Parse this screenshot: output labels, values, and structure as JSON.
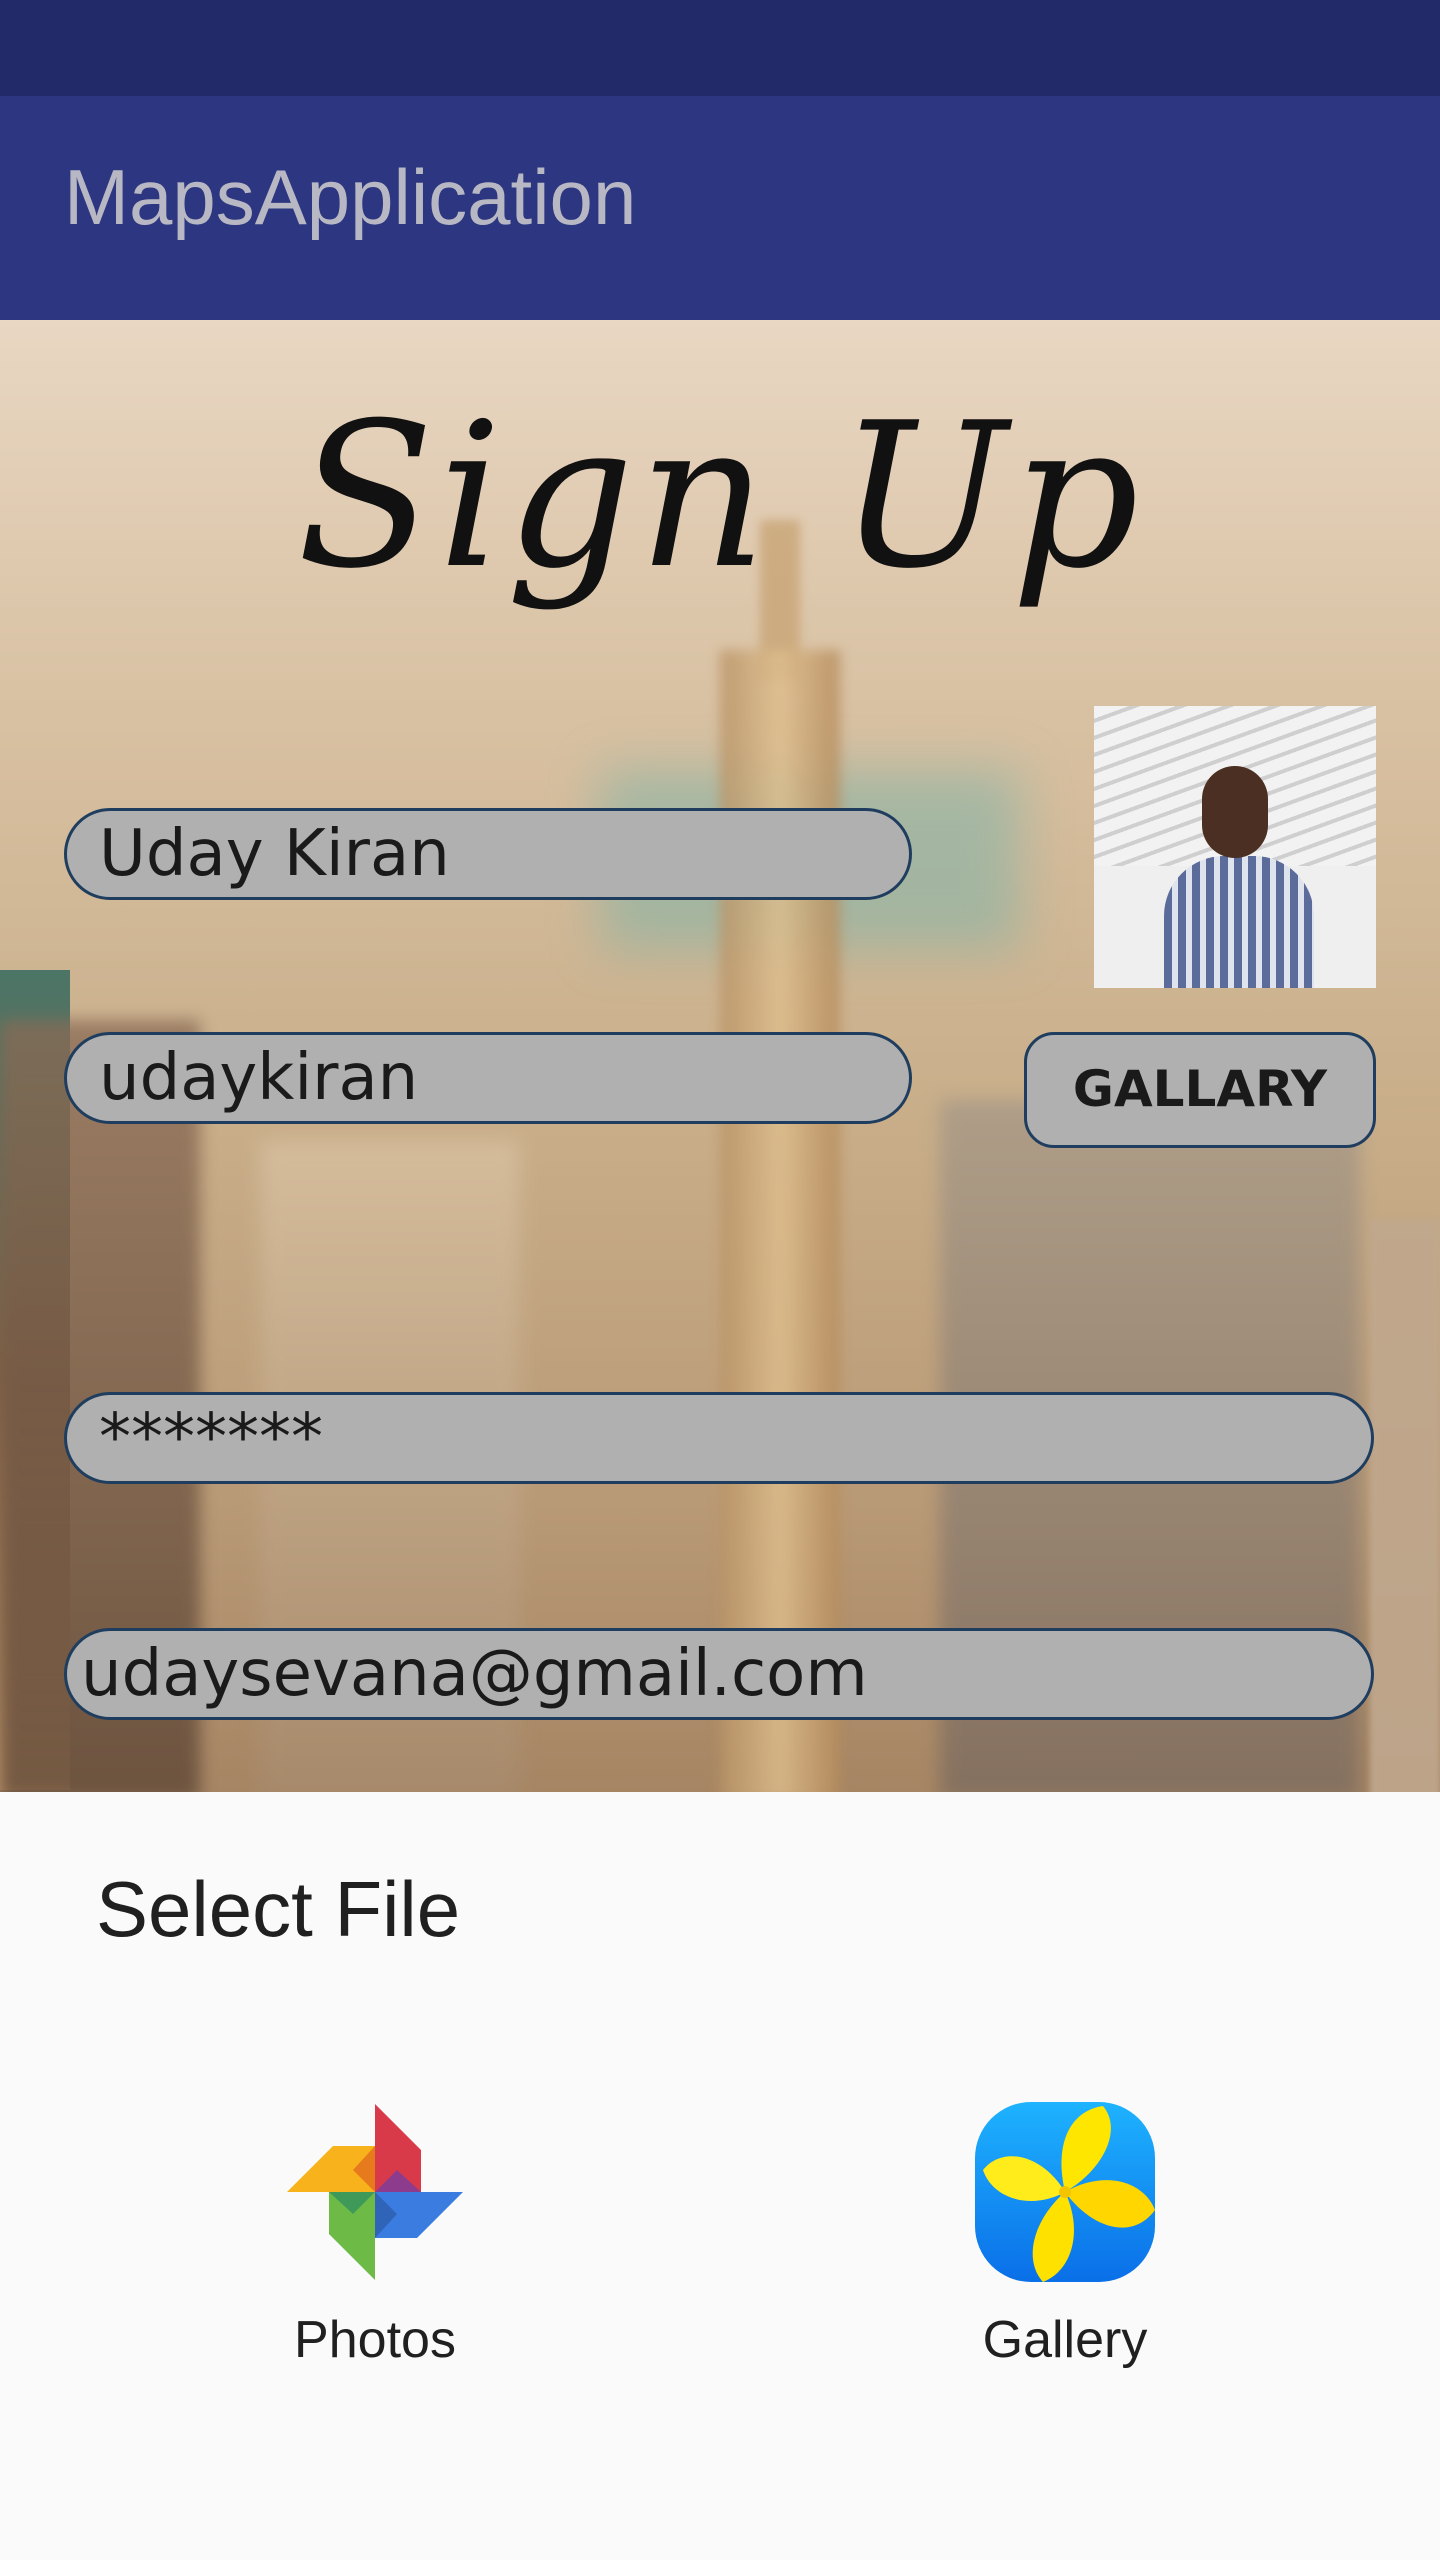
{
  "app_bar": {
    "title": "MapsApplication"
  },
  "signup": {
    "title": "Sign Up"
  },
  "form": {
    "name_value": "Uday Kiran",
    "username_value": "udaykiran",
    "password_value": "*******",
    "email_value": "udaysevana@gmail.com",
    "gallery_button_label": "GALLARY"
  },
  "dialog": {
    "title": "Select File",
    "options": [
      {
        "label": "Photos",
        "icon": "photos-pinwheel-icon"
      },
      {
        "label": "Gallery",
        "icon": "gallery-flower-icon"
      }
    ]
  },
  "colors": {
    "status_bar": "#232a6a",
    "app_bar": "#2d3680",
    "field_fill": "#b0b0b0",
    "field_border": "#1f3d5e"
  }
}
